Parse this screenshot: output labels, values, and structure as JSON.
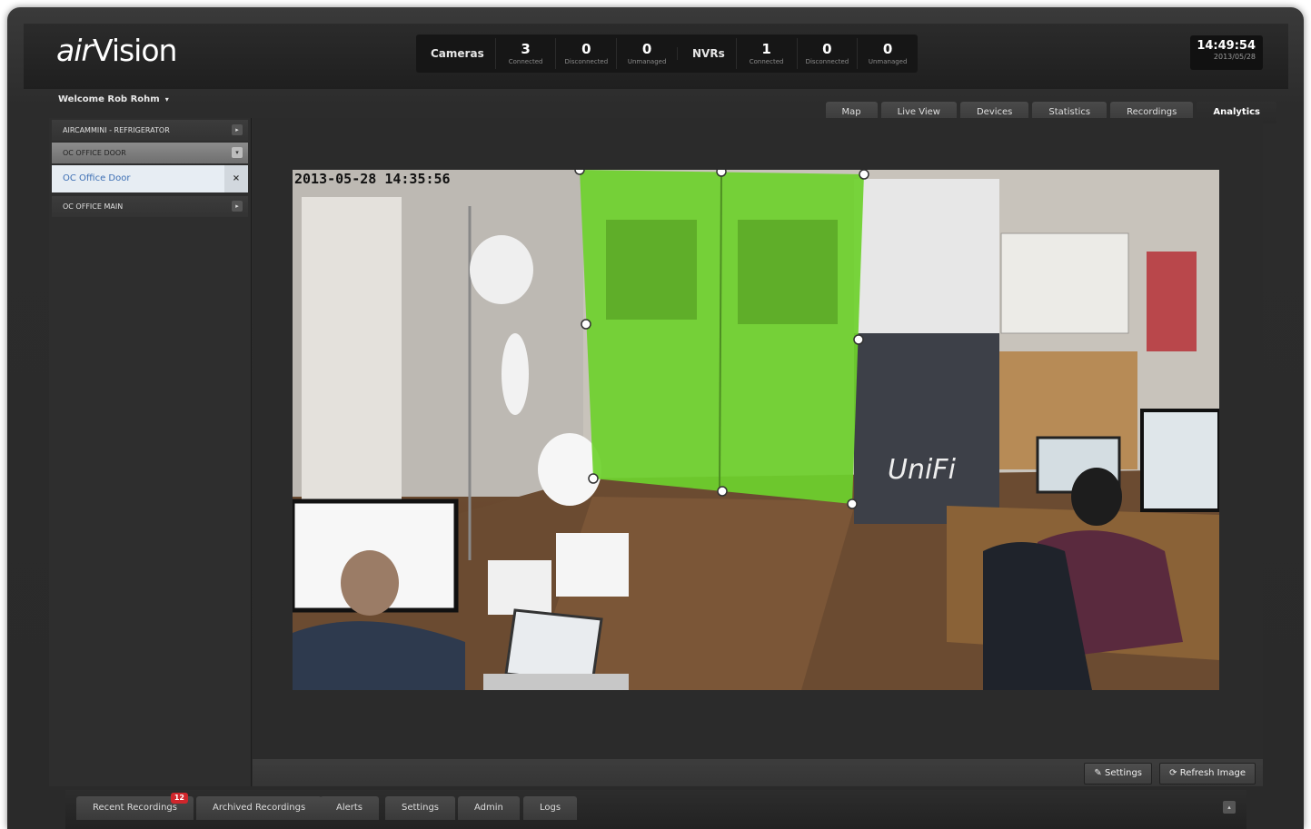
{
  "app": {
    "logo": "airVision",
    "logo_air": "air",
    "logo_vision": "Vision"
  },
  "stats": {
    "cameras_label": "Cameras",
    "cameras": [
      {
        "value": "3",
        "label": "Connected"
      },
      {
        "value": "0",
        "label": "Disconnected"
      },
      {
        "value": "0",
        "label": "Unmanaged"
      }
    ],
    "nvrs_label": "NVRs",
    "nvrs": [
      {
        "value": "1",
        "label": "Connected"
      },
      {
        "value": "0",
        "label": "Disconnected"
      },
      {
        "value": "0",
        "label": "Unmanaged"
      }
    ]
  },
  "clock": {
    "time": "14:49:54",
    "date": "2013/05/28"
  },
  "user": {
    "welcome": "Welcome Rob Rohm",
    "caret": "▾"
  },
  "nav": {
    "tabs": [
      "Map",
      "Live View",
      "Devices",
      "Statistics",
      "Recordings",
      "Analytics"
    ],
    "active": "Analytics"
  },
  "sidebar": {
    "cameras": [
      {
        "label": "AIRCAMMINI - REFRIGERATOR",
        "icon": "▸"
      },
      {
        "label": "OC OFFICE DOOR",
        "icon": "▾"
      },
      {
        "label": "OC Office Door",
        "icon": "×"
      },
      {
        "label": "OC OFFICE MAIN",
        "icon": "▸"
      }
    ]
  },
  "camera": {
    "timestamp": "2013-05-28 14:35:56",
    "zone_color": "#6ed12c",
    "sign_text": "UniFi"
  },
  "toolbar": {
    "settings_label": "Settings",
    "refresh_label": "Refresh Image",
    "settings_icon": "✎",
    "refresh_icon": "⟳"
  },
  "footer": {
    "tabs": [
      "Recent Recordings",
      "Archived Recordings",
      "Alerts",
      "Settings",
      "Admin",
      "Logs"
    ],
    "recent_badge": "12",
    "collapse_icon": "▴"
  }
}
